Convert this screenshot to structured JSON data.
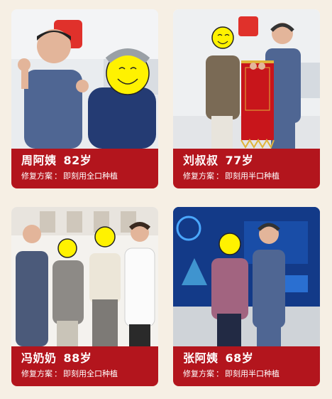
{
  "colors": {
    "page_background": "#f6efe4",
    "caption_background": "#b3151d",
    "caption_text": "#ffffff"
  },
  "cards": [
    {
      "name": "周阿姨",
      "age": "82岁",
      "plan_label": "修复方案",
      "plan_sep": "：",
      "plan_value": "即刻用全口种植"
    },
    {
      "name": "刘叔叔",
      "age": "77岁",
      "plan_label": "修复方案",
      "plan_sep": "：",
      "plan_value": "即刻用半口种植"
    },
    {
      "name": "冯奶奶",
      "age": "88岁",
      "plan_label": "修复方案",
      "plan_sep": "：",
      "plan_value": "即刻用全口种植"
    },
    {
      "name": "张阿姨",
      "age": "68岁",
      "plan_label": "修复方案",
      "plan_sep": "：",
      "plan_value": "即刻用半口种植"
    }
  ]
}
